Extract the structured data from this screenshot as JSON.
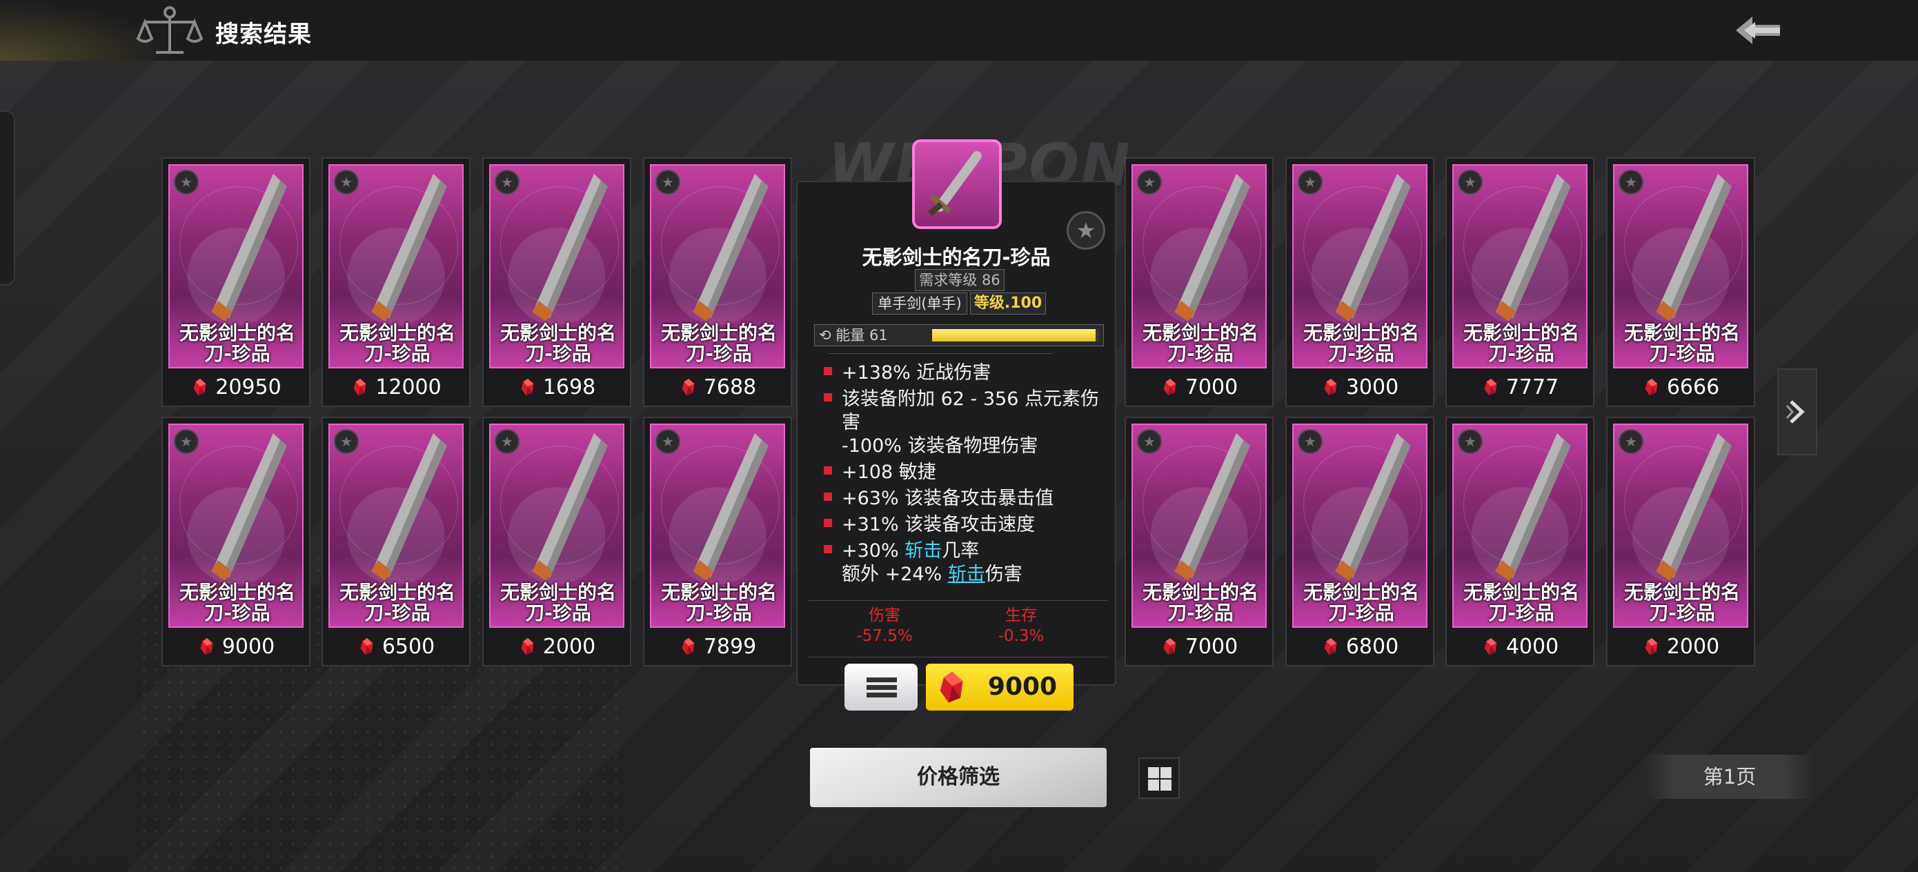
{
  "header": {
    "title": "搜索结果"
  },
  "items": [
    {
      "name": "无影剑士的名刀-珍品",
      "price": "20950"
    },
    {
      "name": "无影剑士的名刀-珍品",
      "price": "12000"
    },
    {
      "name": "无影剑士的名刀-珍品",
      "price": "1698"
    },
    {
      "name": "无影剑士的名刀-珍品",
      "price": "7688"
    },
    {
      "name": "无影剑士的名刀-珍品",
      "price": "7000"
    },
    {
      "name": "无影剑士的名刀-珍品",
      "price": "3000"
    },
    {
      "name": "无影剑士的名刀-珍品",
      "price": "7777"
    },
    {
      "name": "无影剑士的名刀-珍品",
      "price": "6666"
    },
    {
      "name": "无影剑士的名刀-珍品",
      "price": "9000"
    },
    {
      "name": "无影剑士的名刀-珍品",
      "price": "6500"
    },
    {
      "name": "无影剑士的名刀-珍品",
      "price": "2000"
    },
    {
      "name": "无影剑士的名刀-珍品",
      "price": "7899"
    },
    {
      "name": "无影剑士的名刀-珍品",
      "price": "7000"
    },
    {
      "name": "无影剑士的名刀-珍品",
      "price": "6800"
    },
    {
      "name": "无影剑士的名刀-珍品",
      "price": "4000"
    },
    {
      "name": "无影剑士的名刀-珍品",
      "price": "2000"
    }
  ],
  "tooltip": {
    "title": "无影剑士的名刀-珍品",
    "required_level": "需求等级 86",
    "weapon_type": "单手剑(单手)",
    "level": "等级.100",
    "energy_label": "能量 61",
    "energy_fraction": 0.98,
    "stats": [
      {
        "text": "+138% 近战伤害"
      },
      {
        "text": "该装备附加 62 - 356 点元素伤害",
        "sub": "-100% 该装备物理伤害"
      },
      {
        "text": "+108 敏捷"
      },
      {
        "text": "+63% 该装备攻击暴击值"
      },
      {
        "text": "+31% 该装备攻击速度"
      },
      {
        "pre": "+30% ",
        "keyword": "斩击",
        "post": "几率",
        "sub_pre": "额外 +24% ",
        "sub_keyword": "斩击",
        "sub_post": "伤害"
      }
    ],
    "compare": [
      {
        "label": "伤害",
        "value": "-57.5%"
      },
      {
        "label": "生存",
        "value": "-0.3%"
      }
    ],
    "buy_price": "9000"
  },
  "watermark": "WEAPON",
  "filter_button": "价格筛选",
  "page_label": "第1页",
  "colors": {
    "card_pink": "#c2409f",
    "buy_yellow": "#f2c400",
    "stat_bullet": "#e0242b",
    "keyword_cyan": "#3fd8ff",
    "compare_red": "#e02828"
  },
  "icons": [
    "scales-logo-icon",
    "back-arrow-icon",
    "star-icon",
    "sword-icon",
    "red-crystal-icon",
    "menu-icon",
    "chevron-right-icon",
    "grid-view-icon"
  ]
}
